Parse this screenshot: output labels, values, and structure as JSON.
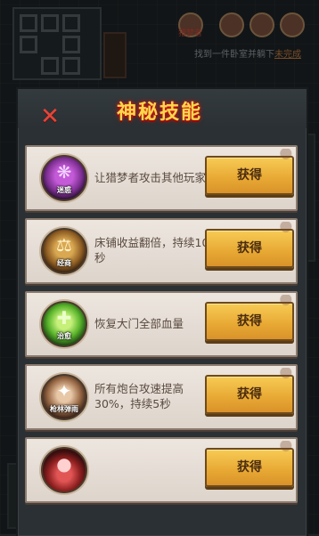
{
  "background": {
    "hud_name": "猎梦者",
    "hud_message_prefix": "找到一件卧室并躺下",
    "hud_message_warn": "未完成"
  },
  "modal": {
    "title": "神秘技能",
    "close_glyph": "✕"
  },
  "skills": [
    {
      "tag": "迷惑",
      "description": "让猎梦者攻击其他玩家",
      "button": "获得",
      "glyph": "❋"
    },
    {
      "tag": "经商",
      "description": "床铺收益翻倍，持续10秒",
      "button": "获得",
      "glyph": "⚖"
    },
    {
      "tag": "治愈",
      "description": "恢复大门全部血量",
      "button": "获得",
      "glyph": "✚"
    },
    {
      "tag": "枪林弹雨",
      "description": "所有炮台攻速提高30%，持续5秒",
      "button": "获得",
      "glyph": "✦"
    },
    {
      "tag": "",
      "description": "",
      "button": "获得",
      "glyph": "●"
    }
  ],
  "colors": {
    "title": "#ffd84a",
    "title_glow": "#dd2222",
    "button": "#e7a833",
    "card": "#e6ded6",
    "close": "#e2473b"
  }
}
